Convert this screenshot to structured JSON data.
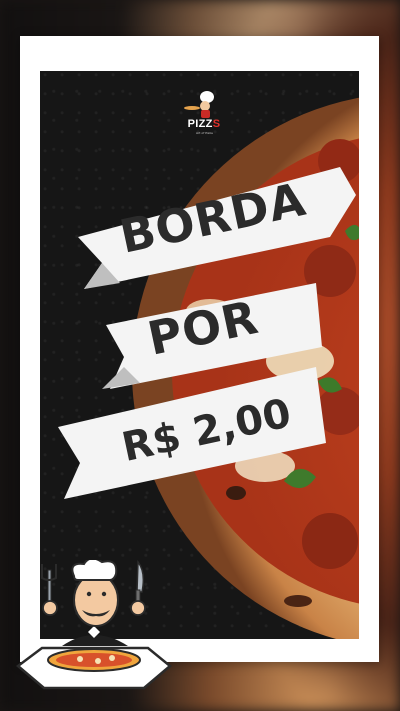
{
  "logo": {
    "name_main": "PIZZ",
    "name_accent": "S",
    "tagline": "Art of Pizza"
  },
  "promo": {
    "line1": "BORDA",
    "line2": "POR",
    "line3": "R$ 2,00"
  },
  "colors": {
    "ribbon": "#f4f4f4",
    "ribbon_text": "#2b2b2b",
    "background": "#161616",
    "logo_accent": "#e0322c"
  },
  "icons": {
    "mascot": "chef-with-fork-and-knife-icon",
    "logo_mascot": "pizza-chef-logo-icon"
  }
}
